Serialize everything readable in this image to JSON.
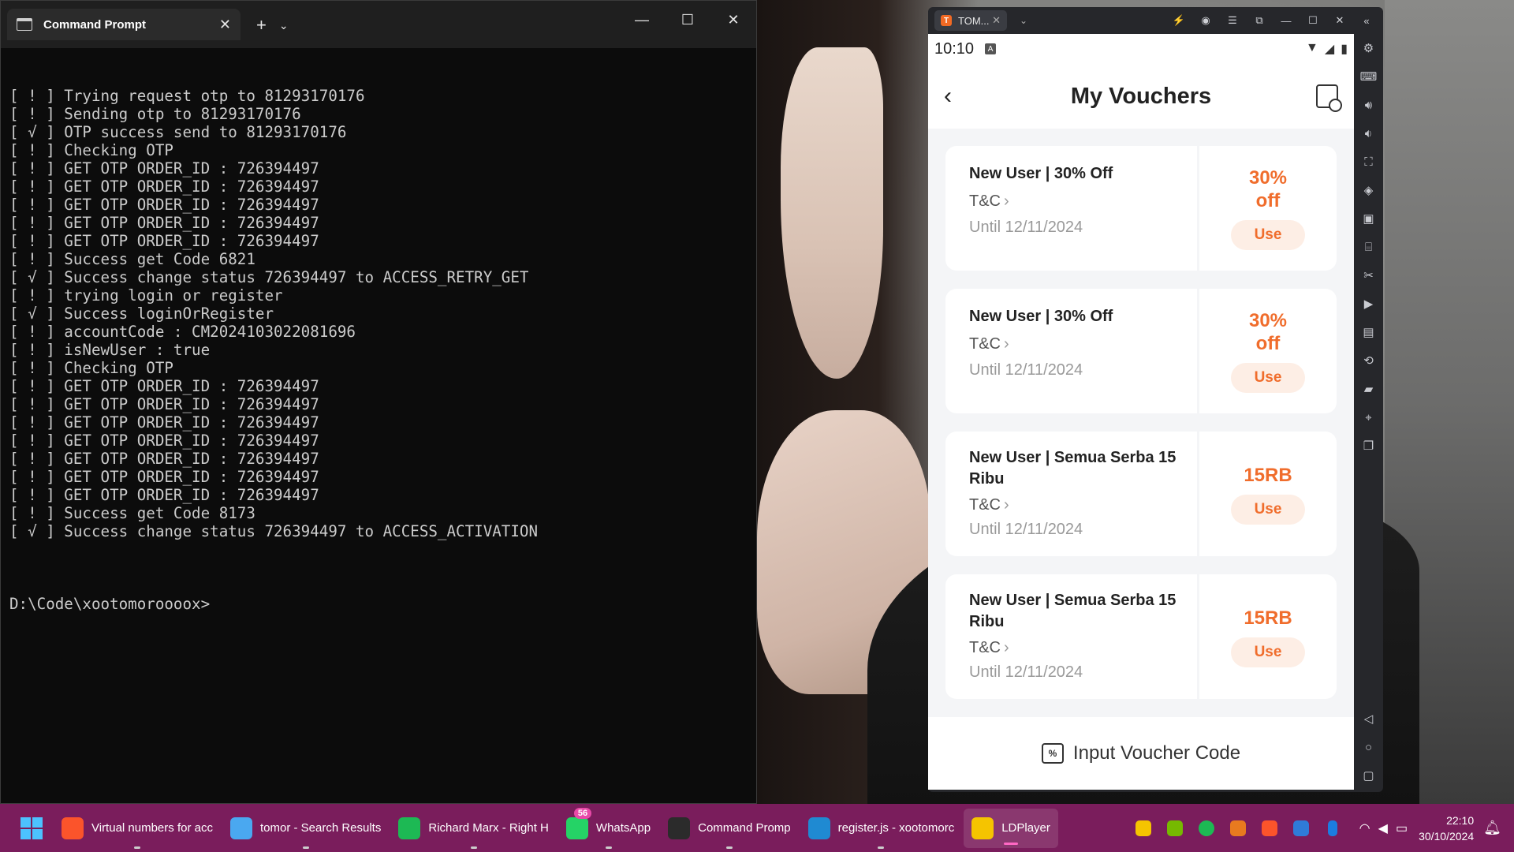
{
  "cmd": {
    "tab_title": "Command Prompt",
    "new_tab": "+",
    "lines": [
      "[ ! ] Trying request otp to 81293170176",
      "[ ! ] Sending otp to 81293170176",
      "[ √ ] OTP success send to 81293170176",
      "[ ! ] Checking OTP",
      "[ ! ] GET OTP ORDER_ID : 726394497",
      "[ ! ] GET OTP ORDER_ID : 726394497",
      "[ ! ] GET OTP ORDER_ID : 726394497",
      "[ ! ] GET OTP ORDER_ID : 726394497",
      "[ ! ] GET OTP ORDER_ID : 726394497",
      "[ ! ] Success get Code 6821",
      "[ √ ] Success change status 726394497 to ACCESS_RETRY_GET",
      "[ ! ] trying login or register",
      "[ √ ] Success loginOrRegister",
      "[ ! ] accountCode : CM2024103022081696",
      "[ ! ] isNewUser : true",
      "[ ! ] Checking OTP",
      "[ ! ] GET OTP ORDER_ID : 726394497",
      "[ ! ] GET OTP ORDER_ID : 726394497",
      "[ ! ] GET OTP ORDER_ID : 726394497",
      "[ ! ] GET OTP ORDER_ID : 726394497",
      "[ ! ] GET OTP ORDER_ID : 726394497",
      "[ ! ] GET OTP ORDER_ID : 726394497",
      "[ ! ] GET OTP ORDER_ID : 726394497",
      "[ ! ] Success get Code 8173",
      "[ √ ] Success change status 726394497 to ACCESS_ACTIVATION"
    ],
    "prompt": "D:\\Code\\xootomoroooox>"
  },
  "emulator": {
    "tab_label": "TOM...",
    "phone": {
      "time": "10:10",
      "status_badge": "A",
      "page_title": "My Vouchers",
      "vouchers": [
        {
          "title": "New User | 30% Off",
          "tc": "T&C",
          "until": "Until 12/11/2024",
          "amount": "30%\noff",
          "button": "Use"
        },
        {
          "title": "New User | 30% Off",
          "tc": "T&C",
          "until": "Until 12/11/2024",
          "amount": "30%\noff",
          "button": "Use"
        },
        {
          "title": "New User | Semua Serba 15 Ribu",
          "tc": "T&C",
          "until": "Until 12/11/2024",
          "amount": "15RB",
          "button": "Use"
        },
        {
          "title": "New User | Semua Serba 15 Ribu",
          "tc": "T&C",
          "until": "Until 12/11/2024",
          "amount": "15RB",
          "button": "Use"
        }
      ],
      "input_voucher_label": "Input Voucher Code"
    }
  },
  "taskbar": {
    "items": [
      {
        "label": "Virtual numbers for acc",
        "icon": "brave-icon",
        "color": "#fb542b"
      },
      {
        "label": "tomor - Search Results",
        "icon": "file-explorer-icon",
        "color": "#4aa8f0"
      },
      {
        "label": "Richard Marx - Right H",
        "icon": "spotify-icon",
        "color": "#1db954"
      },
      {
        "label": "WhatsApp",
        "icon": "whatsapp-icon",
        "color": "#25d366",
        "badge": "56"
      },
      {
        "label": "Command Promp",
        "icon": "terminal-icon",
        "color": "#2b2b2b"
      },
      {
        "label": "register.js - xootomorc",
        "icon": "vscode-icon",
        "color": "#1f8ad2"
      },
      {
        "label": "LDPlayer",
        "icon": "ldplayer-icon",
        "color": "#f5c400"
      }
    ],
    "clock": {
      "time": "22:10",
      "date": "30/10/2024"
    }
  }
}
